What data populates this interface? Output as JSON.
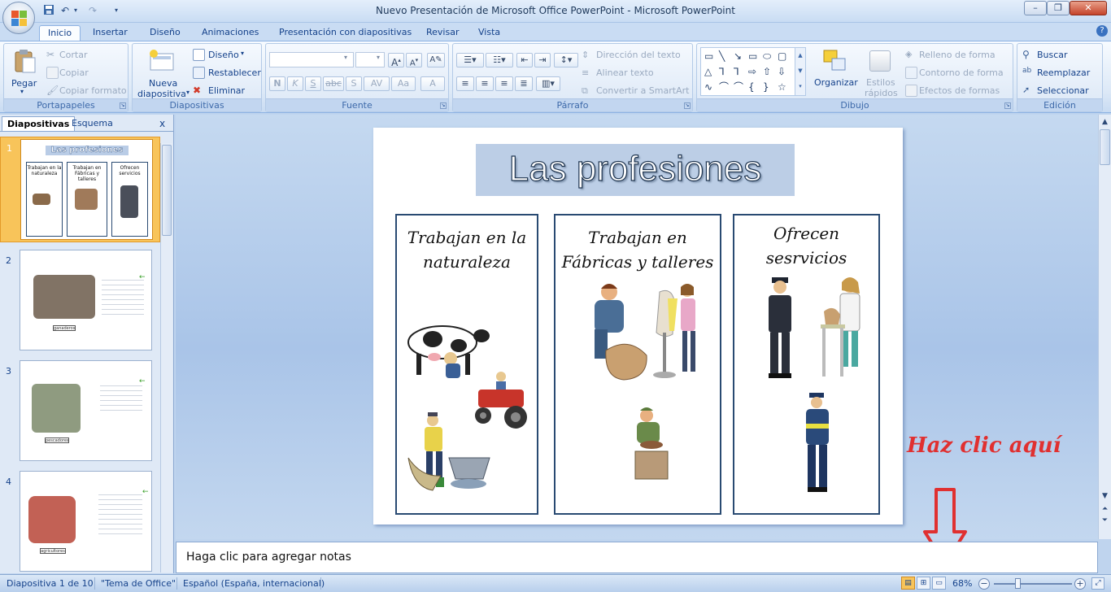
{
  "window": {
    "title": "Nuevo Presentación de Microsoft Office PowerPoint - Microsoft PowerPoint"
  },
  "tabs": [
    "Inicio",
    "Insertar",
    "Diseño",
    "Animaciones",
    "Presentación con diapositivas",
    "Revisar",
    "Vista"
  ],
  "ribbon": {
    "portapapeles": {
      "paste": "Pegar",
      "cut": "Cortar",
      "copy": "Copiar",
      "format_painter": "Copiar formato",
      "label": "Portapapeles"
    },
    "diapositivas": {
      "new_line1": "Nueva",
      "new_line2": "diapositiva",
      "layout": "Diseño",
      "reset": "Restablecer",
      "delete": "Eliminar",
      "label": "Diapositivas"
    },
    "fuente": {
      "label": "Fuente",
      "bold": "N",
      "italic": "K",
      "underline": "S",
      "strike": "abc",
      "spacing": "AV",
      "case": "Aa",
      "color": "A"
    },
    "parrafo": {
      "text_direction": "Dirección del texto",
      "align_text": "Alinear texto",
      "smartart": "Convertir a SmartArt",
      "label": "Párrafo"
    },
    "dibujo": {
      "arrange": "Organizar",
      "styles_line1": "Estilos",
      "styles_line2": "rápidos",
      "fill": "Relleno de forma",
      "outline": "Contorno de forma",
      "effects": "Efectos de formas",
      "label": "Dibujo"
    },
    "edicion": {
      "find": "Buscar",
      "replace": "Reemplazar",
      "select": "Seleccionar",
      "label": "Edición"
    }
  },
  "slides_pane": {
    "tab_slides": "Diapositivas",
    "tab_outline": "Esquema",
    "close": "x",
    "thumbs": [
      {
        "num": "1",
        "title": "Las profesiones",
        "cols": [
          "Trabajan en la naturaleza",
          "Trabajan en Fábricas y talleres",
          "Ofrecen servicios"
        ]
      },
      {
        "num": "2",
        "caption": "ganaderos"
      },
      {
        "num": "3",
        "caption": "pescadores"
      },
      {
        "num": "4",
        "caption": "agricultores"
      }
    ]
  },
  "slide": {
    "title": "Las profesiones",
    "columns": [
      {
        "line1": "Trabajan en la",
        "line2": "naturaleza"
      },
      {
        "line1": "Trabajan en",
        "line2": "Fábricas y talleres"
      },
      {
        "line1": "Ofrecen",
        "line2": "sesrvicios"
      }
    ]
  },
  "notes": {
    "placeholder": "Haga clic para agregar notas"
  },
  "annotation": {
    "text": "Haz clic aquí"
  },
  "statusbar": {
    "slide_info": "Diapositiva 1 de 10",
    "theme": "\"Tema de Office\"",
    "language": "Español (España, internacional)",
    "zoom": "68%"
  },
  "colors": {
    "ribbon_blue": "#bfd4ee",
    "selected_thumb": "#f8c45a",
    "annotation_red": "#e03030"
  }
}
